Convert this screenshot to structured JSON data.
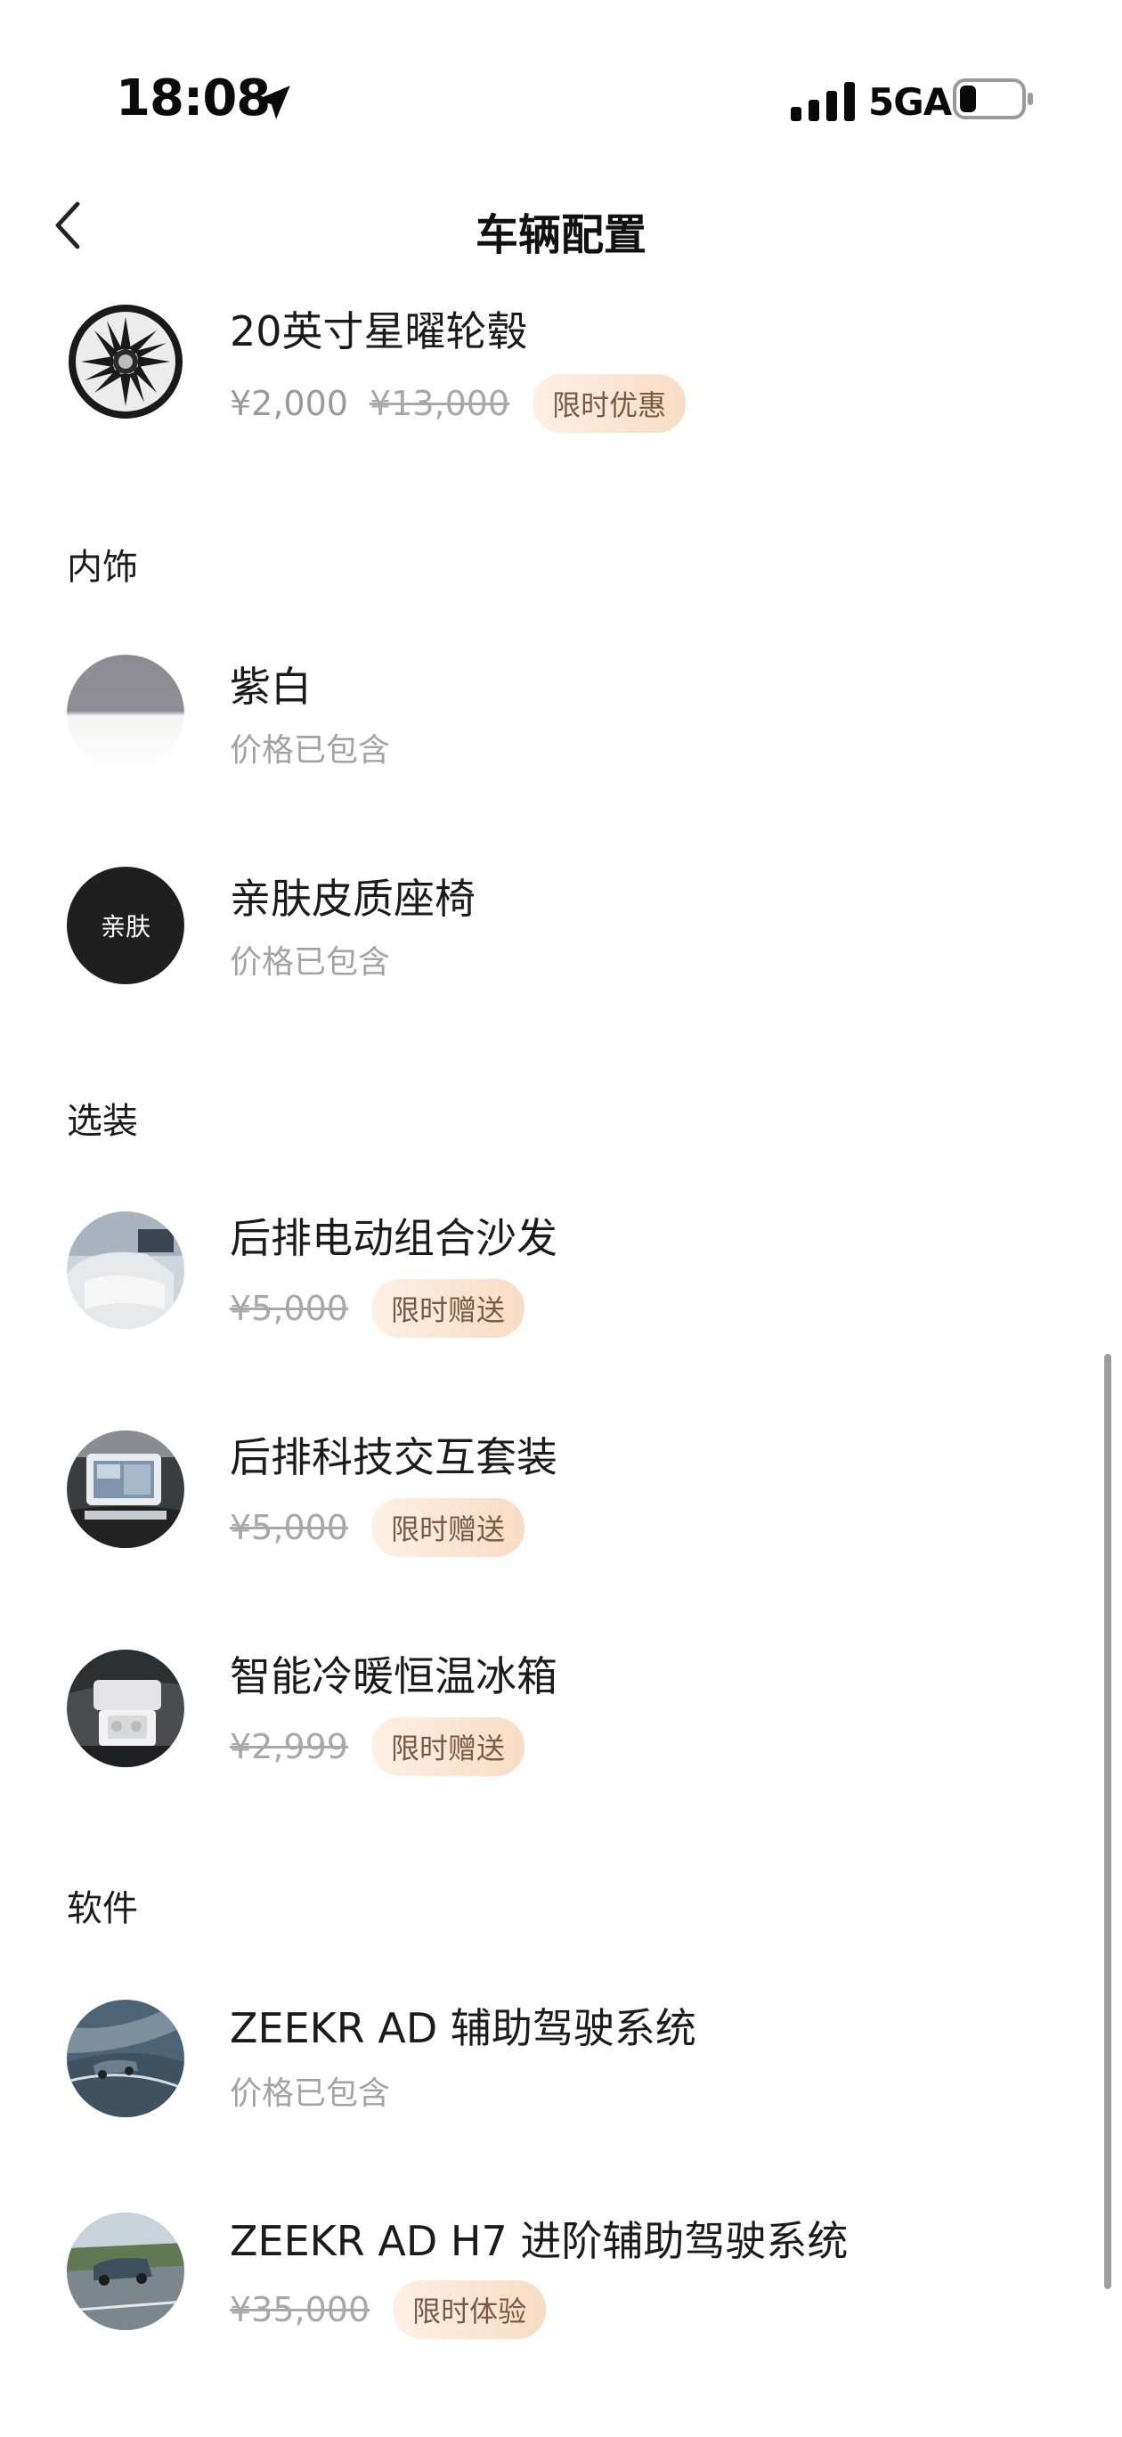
{
  "status_bar": {
    "time": "18:08",
    "network": "5GA"
  },
  "header": {
    "title": "车辆配置"
  },
  "wheel_item": {
    "title": "20英寸星曜轮毂",
    "price": "¥2,000",
    "original_price": "¥13,000",
    "badge": "限时优惠"
  },
  "sections": {
    "interior": "内饰",
    "options": "选装",
    "software": "软件"
  },
  "interior_items": [
    {
      "title": "紫白",
      "sub": "价格已包含"
    },
    {
      "title": "亲肤皮质座椅",
      "sub": "价格已包含",
      "thumb_text": "亲肤"
    }
  ],
  "option_items": [
    {
      "title": "后排电动组合沙发",
      "original_price": "¥5,000",
      "badge": "限时赠送"
    },
    {
      "title": "后排科技交互套装",
      "original_price": "¥5,000",
      "badge": "限时赠送"
    },
    {
      "title": "智能冷暖恒温冰箱",
      "original_price": "¥2,999",
      "badge": "限时赠送"
    }
  ],
  "software_items": [
    {
      "title": "ZEEKR AD 辅助驾驶系统",
      "sub": "价格已包含"
    },
    {
      "title": "ZEEKR AD H7 进阶辅助驾驶系统",
      "original_price": "¥35,000",
      "badge": "限时体验"
    }
  ],
  "colors": {
    "badge_bg": "#f8dcc4",
    "badge_text": "#7a5a43",
    "muted": "#9a9a9a"
  }
}
